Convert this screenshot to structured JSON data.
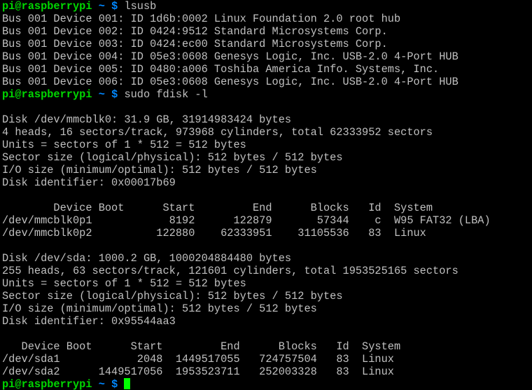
{
  "colors": {
    "background": "#000000",
    "text": "#c0c0c0",
    "prompt_user": "#00d700",
    "prompt_path": "#0087ff",
    "cursor": "#00ff00"
  },
  "prompt": {
    "user_host": "pi@raspberrypi",
    "path": "~",
    "symbol": "$"
  },
  "blocks": [
    {
      "command": "lsusb",
      "output": [
        "Bus 001 Device 001: ID 1d6b:0002 Linux Foundation 2.0 root hub",
        "Bus 001 Device 002: ID 0424:9512 Standard Microsystems Corp.",
        "Bus 001 Device 003: ID 0424:ec00 Standard Microsystems Corp.",
        "Bus 001 Device 004: ID 05e3:0608 Genesys Logic, Inc. USB-2.0 4-Port HUB",
        "Bus 001 Device 005: ID 0480:a006 Toshiba America Info. Systems, Inc.",
        "Bus 001 Device 006: ID 05e3:0608 Genesys Logic, Inc. USB-2.0 4-Port HUB"
      ]
    },
    {
      "command": "sudo fdisk -l",
      "output": [
        "",
        "Disk /dev/mmcblk0: 31.9 GB, 31914983424 bytes",
        "4 heads, 16 sectors/track, 973968 cylinders, total 62333952 sectors",
        "Units = sectors of 1 * 512 = 512 bytes",
        "Sector size (logical/physical): 512 bytes / 512 bytes",
        "I/O size (minimum/optimal): 512 bytes / 512 bytes",
        "Disk identifier: 0x00017b69",
        "",
        "        Device Boot      Start         End      Blocks   Id  System",
        "/dev/mmcblk0p1            8192      122879       57344    c  W95 FAT32 (LBA)",
        "/dev/mmcblk0p2          122880    62333951    31105536   83  Linux",
        "",
        "Disk /dev/sda: 1000.2 GB, 1000204884480 bytes",
        "255 heads, 63 sectors/track, 121601 cylinders, total 1953525165 sectors",
        "Units = sectors of 1 * 512 = 512 bytes",
        "Sector size (logical/physical): 512 bytes / 512 bytes",
        "I/O size (minimum/optimal): 512 bytes / 512 bytes",
        "Disk identifier: 0x95544aa3",
        "",
        "   Device Boot      Start         End      Blocks   Id  System",
        "/dev/sda1            2048  1449517055   724757504   83  Linux",
        "/dev/sda2      1449517056  1953523711   252003328   83  Linux"
      ]
    }
  ],
  "current_input": ""
}
